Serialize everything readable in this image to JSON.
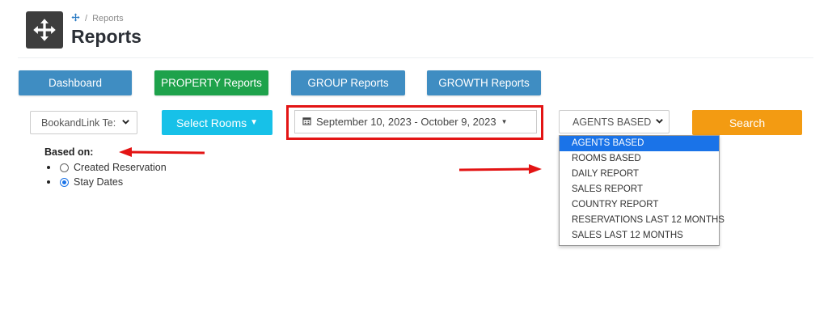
{
  "header": {
    "breadcrumb": [
      "Reports"
    ],
    "title": "Reports",
    "logo_icon": "move-arrows-icon"
  },
  "nav": {
    "buttons": [
      {
        "label": "Dashboard",
        "color": "#3f8dc2"
      },
      {
        "label": "PROPERTY Reports",
        "color": "#1ea24b"
      },
      {
        "label": "GROUP Reports",
        "color": "#3f8dc2"
      },
      {
        "label": "GROWTH Reports",
        "color": "#3f8dc2"
      }
    ]
  },
  "filters": {
    "property_value": "BookandLink Te:",
    "rooms_label": "Select Rooms",
    "date_range": "September 10, 2023 - October 9, 2023",
    "report_type_value": "AGENTS BASED",
    "search_label": "Search"
  },
  "based_on": {
    "label": "Based on:",
    "options": [
      {
        "label": "Created Reservation",
        "checked": false
      },
      {
        "label": "Stay Dates",
        "checked": true
      }
    ]
  },
  "report_options": [
    "AGENTS BASED",
    "ROOMS BASED",
    "DAILY REPORT",
    "SALES REPORT",
    "COUNTRY REPORT",
    "RESERVATIONS LAST 12 MONTHS",
    "SALES LAST 12 MONTHS"
  ],
  "colors": {
    "annotation_red": "#e31414",
    "accent_blue": "#1a73e8",
    "search_orange": "#f39b12",
    "rooms_cyan": "#17c1e8"
  }
}
